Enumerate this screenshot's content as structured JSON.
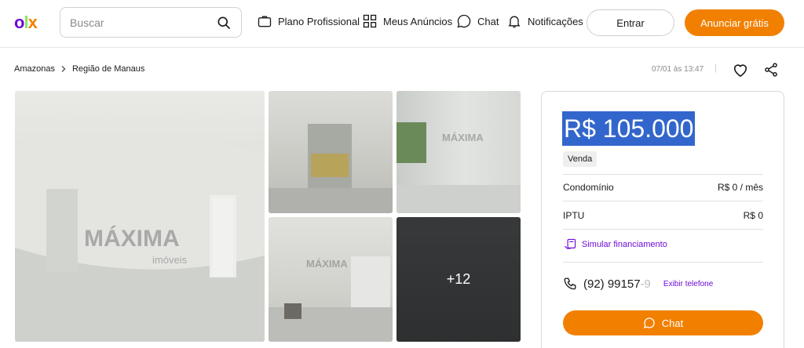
{
  "header": {
    "logo": "olx",
    "search": {
      "placeholder": "Buscar",
      "icon": "search-icon"
    },
    "nav": [
      {
        "label": "Plano Profissional",
        "icon": "briefcase-icon"
      },
      {
        "label": "Meus Anúncios",
        "icon": "grid-icon"
      },
      {
        "label": "Chat",
        "icon": "chat-bubble-icon"
      },
      {
        "label": "Notificações",
        "icon": "bell-icon"
      }
    ],
    "login_label": "Entrar",
    "post_ad_label": "Anunciar grátis"
  },
  "breadcrumb": {
    "items": [
      "Amazonas",
      "Região de Manaus"
    ],
    "separator_icon": "chevron-right-icon"
  },
  "meta": {
    "date": "07/01 às 13:47",
    "separator": "|",
    "favorite_icon": "heart-icon",
    "share_icon": "share-icon"
  },
  "gallery": {
    "more_count": "+12",
    "watermark_top": "MÁXIMA",
    "watermark_bottom": "imóveis"
  },
  "listing": {
    "price": "R$ 105.000",
    "type_tag": "Venda",
    "details": [
      {
        "label": "Condomínio",
        "value": "R$ 0 / mês"
      },
      {
        "label": "IPTU",
        "value": "R$ 0"
      }
    ],
    "simulate_label": "Simular financiamento",
    "phone_visible": "(92) 99157",
    "phone_faded": "-9",
    "show_phone_label": "Exibir telefone",
    "chat_label": "Chat"
  },
  "colors": {
    "accent_orange": "#f28000",
    "accent_purple": "#6e0ad6",
    "highlight_blue": "#3366cc"
  }
}
